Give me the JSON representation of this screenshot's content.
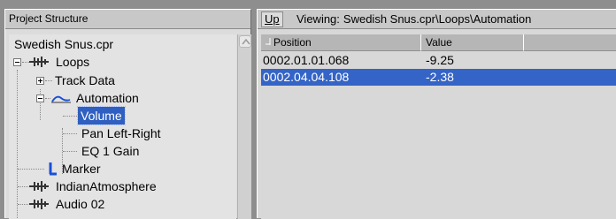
{
  "left_panel": {
    "title": "Project Structure",
    "tree": {
      "root": "Swedish Snus.cpr",
      "loops": "Loops",
      "track_data": "Track Data",
      "automation": "Automation",
      "volume": "Volume",
      "pan": "Pan Left-Right",
      "eq": "EQ 1 Gain",
      "marker": "Marker",
      "indian": "IndianAtmosphere",
      "audio02": "Audio 02"
    }
  },
  "right_panel": {
    "up_button": "Up",
    "viewing_label": "Viewing:",
    "viewing_path": "Swedish Snus.cpr\\Loops\\Automation",
    "columns": [
      "Position",
      "Value",
      ""
    ],
    "rows": [
      {
        "position": "0002.01.01.068",
        "value": "-9.25"
      },
      {
        "position": "0002.04.04.108",
        "value": "-2.38"
      }
    ]
  },
  "colors": {
    "selection": "#3464c6",
    "automation_icon": "#1b4fd6",
    "marker_icon": "#1b4fd6"
  },
  "icons": {
    "audio_track": "waveform-icon",
    "automation": "automation-curve-icon",
    "marker": "marker-icon"
  }
}
